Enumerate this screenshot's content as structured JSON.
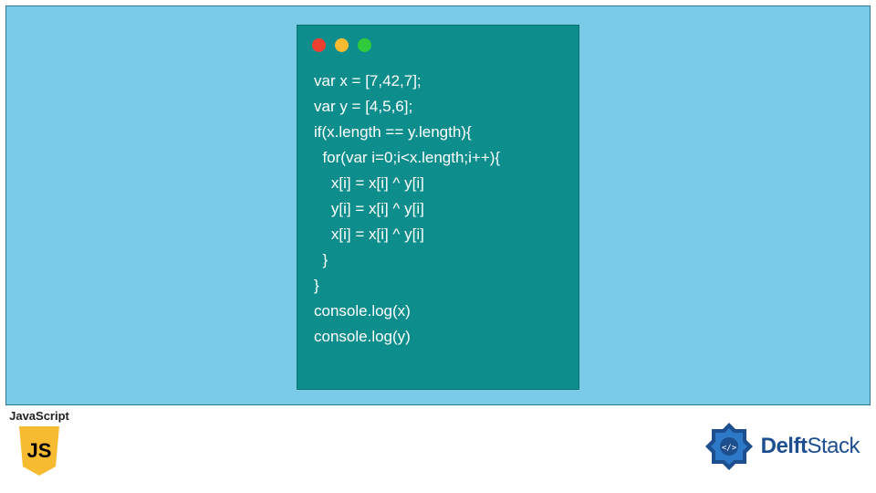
{
  "code_lines": [
    "var x = [7,42,7];",
    "var y = [4,5,6];",
    "if(x.length == y.length){",
    "  for(var i=0;i<x.length;i++){",
    "    x[i] = x[i] ^ y[i]",
    "    y[i] = x[i] ^ y[i]",
    "    x[i] = x[i] ^ y[i]",
    "  }",
    "}",
    "console.log(x)",
    "console.log(y)"
  ],
  "js_badge": {
    "label": "JavaScript",
    "letters": "JS"
  },
  "brand": {
    "bold": "Delft",
    "rest": "Stack"
  },
  "colors": {
    "banner_bg": "#79cbe8",
    "window_bg": "#0e8d8d",
    "js_yellow": "#f6bb31",
    "brand_blue": "#1d4f8f"
  }
}
